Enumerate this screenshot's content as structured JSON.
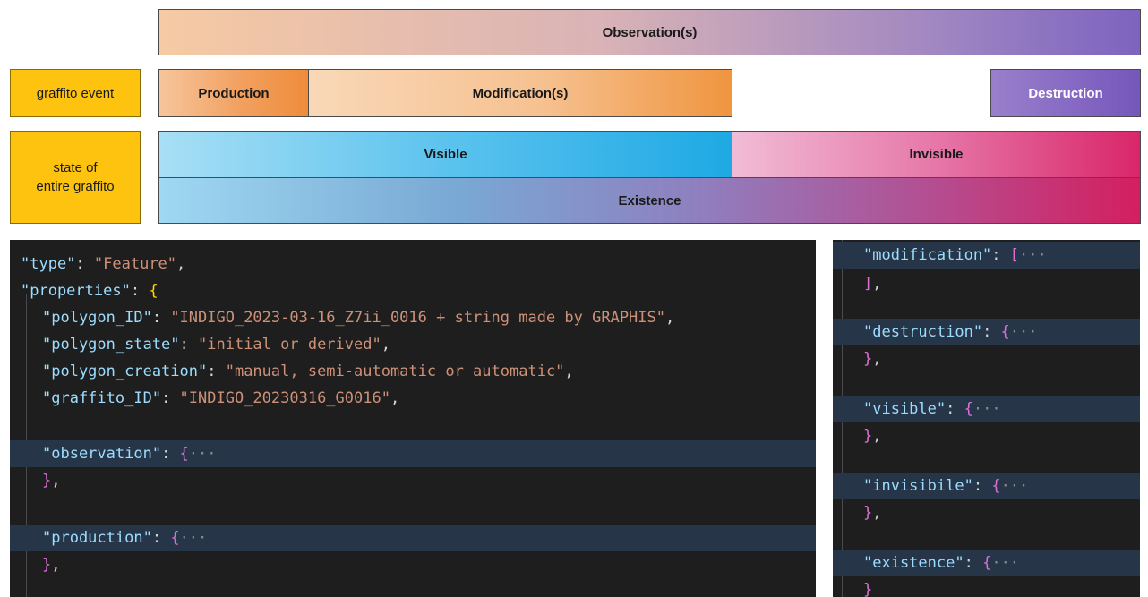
{
  "timeline": {
    "observation": "Observation(s)",
    "graffito_event_label": "graffito event",
    "production": "Production",
    "modification": "Modification(s)",
    "destruction": "Destruction",
    "state_label_line1": "state of",
    "state_label_line2": "entire graffito",
    "visible": "Visible",
    "invisible": "Invisible",
    "existence": "Existence"
  },
  "code_left": {
    "type_key": "\"type\"",
    "type_value": "\"Feature\"",
    "properties_key": "\"properties\"",
    "polygon_id_key": "\"polygon_ID\"",
    "polygon_id_value": "\"INDIGO_2023-03-16_Z7ii_0016 + string made by GRAPHIS\"",
    "polygon_state_key": "\"polygon_state\"",
    "polygon_state_value": "\"initial or derived\"",
    "polygon_creation_key": "\"polygon_creation\"",
    "polygon_creation_value": "\"manual, semi-automatic or automatic\"",
    "graffito_id_key": "\"graffito_ID\"",
    "graffito_id_value": "\"INDIGO_20230316_G0016\"",
    "observation_key": "\"observation\"",
    "production_key": "\"production\""
  },
  "code_right": {
    "modification_key": "\"modification\"",
    "destruction_key": "\"destruction\"",
    "visible_key": "\"visible\"",
    "invisibile_key": "\"invisibile\"",
    "existence_key": "\"existence\""
  },
  "code_symbols": {
    "colon": ": ",
    "comma": ",",
    "open_brace": "{",
    "close_brace": "}",
    "open_bracket": "[",
    "close_bracket": "]",
    "ellipsis": "···"
  },
  "colors": {
    "label_fill": "#fdc30f",
    "code_bg": "#1e1e1e",
    "code_key": "#9cdcfe",
    "code_string": "#ce9178",
    "code_bracket": "#da70d6"
  }
}
